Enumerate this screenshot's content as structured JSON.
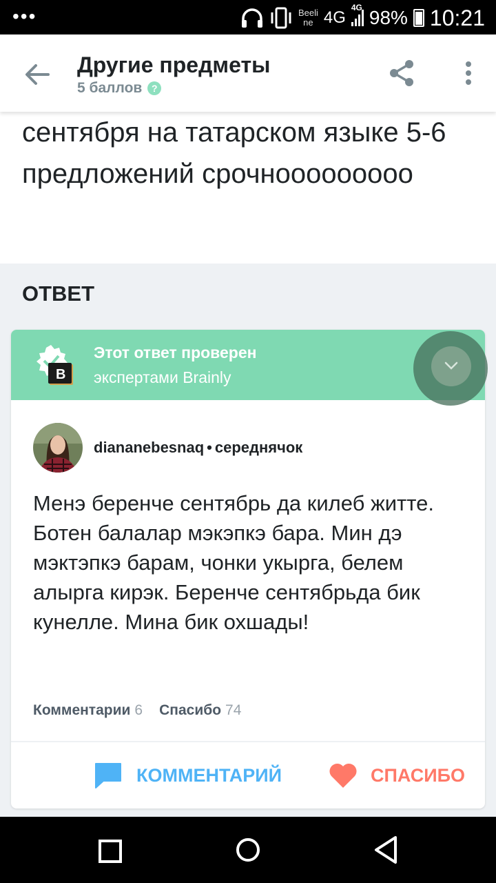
{
  "status_bar": {
    "carrier_line1": "Beeli",
    "carrier_line2": "ne",
    "network": "4G",
    "network2": "4G",
    "battery": "98%",
    "time": "10:21"
  },
  "header": {
    "title": "Другие предметы",
    "points": "5 баллов",
    "help_glyph": "?"
  },
  "question": {
    "text": "сентября на татарском языке 5-6 предложений срочнооооооооо"
  },
  "answer_section": {
    "heading": "ОТВЕТ"
  },
  "answer": {
    "verified_title": "Этот ответ проверен",
    "verified_subtitle": "экспертами Brainly",
    "author_name": "diananebesnaq",
    "author_rank": "середнячок",
    "text": "Менэ беренче сентябрь да килеб житте. Ботен балалар мэкэпкэ бара. Мин дэ мэктэпкэ барам, чонки укырга, белем алырга кирэк. Беренче сентябрьда бик кунелле. Мина бик охшады!",
    "comments_label": "Комментарии",
    "comments_count": "6",
    "thanks_label": "Спасибо",
    "thanks_count": "74",
    "comment_button": "КОММЕНТАРИЙ",
    "thanks_button": "СПАСИБО"
  },
  "colors": {
    "verified_bg": "#7fd9b2",
    "comment_blue": "#4fb3f6",
    "thanks_red": "#ff7968"
  },
  "icons": [
    "back-arrow-icon",
    "share-icon",
    "more-vertical-icon",
    "verified-badge-icon",
    "comment-icon",
    "heart-icon",
    "chevron-down-icon",
    "nav-back-icon",
    "nav-home-icon",
    "nav-recent-icon"
  ]
}
